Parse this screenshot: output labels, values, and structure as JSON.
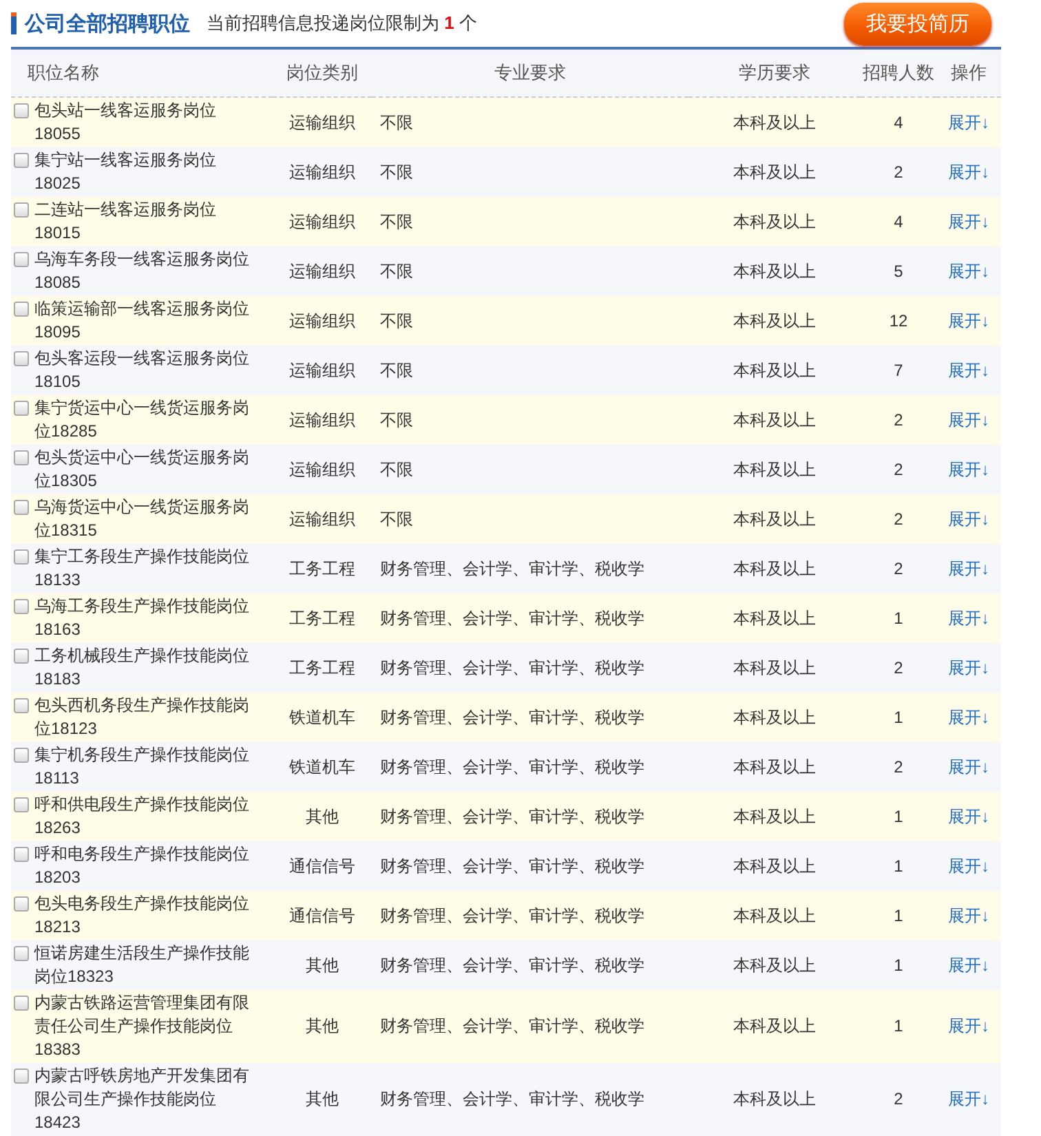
{
  "header": {
    "title": "公司全部招聘职位",
    "limit_text": "当前招聘信息投递岗位限制为 **1** 个",
    "apply_button": "我要投简历"
  },
  "table": {
    "columns": [
      "职位名称",
      "岗位类别",
      "专业要求",
      "学历要求",
      "招聘人数",
      "操作"
    ],
    "rows": [
      {
        "name": "包头站一线客运服务岗位18055",
        "category": "运输组织",
        "major": "不限",
        "education": "本科及以上",
        "count": "4",
        "action": "展开↓",
        "checked": false
      },
      {
        "name": "集宁站一线客运服务岗位18025",
        "category": "运输组织",
        "major": "不限",
        "education": "本科及以上",
        "count": "2",
        "action": "展开↓",
        "checked": false
      },
      {
        "name": "二连站一线客运服务岗位18015",
        "category": "运输组织",
        "major": "不限",
        "education": "本科及以上",
        "count": "4",
        "action": "展开↓",
        "checked": false
      },
      {
        "name": "乌海车务段一线客运服务岗位18085",
        "category": "运输组织",
        "major": "不限",
        "education": "本科及以上",
        "count": "5",
        "action": "展开↓",
        "checked": false
      },
      {
        "name": "临策运输部一线客运服务岗位18095",
        "category": "运输组织",
        "major": "不限",
        "education": "本科及以上",
        "count": "12",
        "action": "展开↓",
        "checked": false
      },
      {
        "name": "包头客运段一线客运服务岗位18105",
        "category": "运输组织",
        "major": "不限",
        "education": "本科及以上",
        "count": "7",
        "action": "展开↓",
        "checked": false
      },
      {
        "name": "集宁货运中心一线货运服务岗位18285",
        "category": "运输组织",
        "major": "不限",
        "education": "本科及以上",
        "count": "2",
        "action": "展开↓",
        "checked": false
      },
      {
        "name": "包头货运中心一线货运服务岗位18305",
        "category": "运输组织",
        "major": "不限",
        "education": "本科及以上",
        "count": "2",
        "action": "展开↓",
        "checked": false
      },
      {
        "name": "乌海货运中心一线货运服务岗位18315",
        "category": "运输组织",
        "major": "不限",
        "education": "本科及以上",
        "count": "2",
        "action": "展开↓",
        "checked": false
      },
      {
        "name": "集宁工务段生产操作技能岗位18133",
        "category": "工务工程",
        "major": "财务管理、会计学、审计学、税收学",
        "education": "本科及以上",
        "count": "2",
        "action": "展开↓",
        "checked": false
      },
      {
        "name": "乌海工务段生产操作技能岗位18163",
        "category": "工务工程",
        "major": "财务管理、会计学、审计学、税收学",
        "education": "本科及以上",
        "count": "1",
        "action": "展开↓",
        "checked": false
      },
      {
        "name": "工务机械段生产操作技能岗位18183",
        "category": "工务工程",
        "major": "财务管理、会计学、审计学、税收学",
        "education": "本科及以上",
        "count": "2",
        "action": "展开↓",
        "checked": false
      },
      {
        "name": "包头西机务段生产操作技能岗位18123",
        "category": "铁道机车",
        "major": "财务管理、会计学、审计学、税收学",
        "education": "本科及以上",
        "count": "1",
        "action": "展开↓",
        "checked": false
      },
      {
        "name": "集宁机务段生产操作技能岗位18113",
        "category": "铁道机车",
        "major": "财务管理、会计学、审计学、税收学",
        "education": "本科及以上",
        "count": "2",
        "action": "展开↓",
        "checked": false
      },
      {
        "name": "呼和供电段生产操作技能岗位18263",
        "category": "其他",
        "major": "财务管理、会计学、审计学、税收学",
        "education": "本科及以上",
        "count": "1",
        "action": "展开↓",
        "checked": false
      },
      {
        "name": "呼和电务段生产操作技能岗位18203",
        "category": "通信信号",
        "major": "财务管理、会计学、审计学、税收学",
        "education": "本科及以上",
        "count": "1",
        "action": "展开↓",
        "checked": false
      },
      {
        "name": "包头电务段生产操作技能岗位18213",
        "category": "通信信号",
        "major": "财务管理、会计学、审计学、税收学",
        "education": "本科及以上",
        "count": "1",
        "action": "展开↓",
        "checked": false
      },
      {
        "name": "恒诺房建生活段生产操作技能岗位18323",
        "category": "其他",
        "major": "财务管理、会计学、审计学、税收学",
        "education": "本科及以上",
        "count": "1",
        "action": "展开↓",
        "checked": false
      },
      {
        "name": "内蒙古铁路运营管理集团有限责任公司生产操作技能岗位18383",
        "category": "其他",
        "major": "财务管理、会计学、审计学、税收学",
        "education": "本科及以上",
        "count": "1",
        "action": "展开↓",
        "checked": false
      },
      {
        "name": "内蒙古呼铁房地产开发集团有限公司生产操作技能岗位18423",
        "category": "其他",
        "major": "财务管理、会计学、审计学、税收学",
        "education": "本科及以上",
        "count": "2",
        "action": "展开↓",
        "checked": false
      }
    ]
  }
}
